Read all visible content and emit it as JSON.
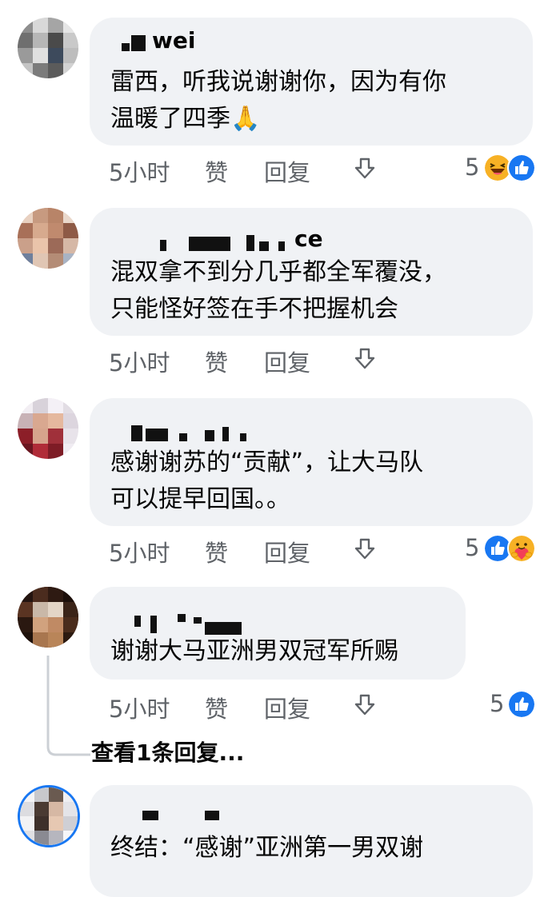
{
  "comments": [
    {
      "name_obscured": "wei",
      "lines": [
        "雷西，听我说谢谢你，因为有你",
        "温暖了四季🙏"
      ],
      "time": "5小时",
      "like": "赞",
      "reply": "回复",
      "reactions_count": "5",
      "reactions": [
        "haha-icon",
        "like-icon"
      ]
    },
    {
      "name_obscured": "ce",
      "lines": [
        "混双拿不到分几乎都全军覆没，",
        "只能怪好签在手不把握机会"
      ],
      "time": "5小时",
      "like": "赞",
      "reply": "回复",
      "reactions_count": "",
      "reactions": []
    },
    {
      "name_obscured": "",
      "lines": [
        "感谢谢苏的“贡献”，让大马队",
        "可以提早回国。。"
      ],
      "time": "5小时",
      "like": "赞",
      "reply": "回复",
      "reactions_count": "5",
      "reactions": [
        "like-icon",
        "care-icon"
      ]
    },
    {
      "name_obscured": "",
      "lines": [
        "谢谢大马亚洲男双冠军所赐"
      ],
      "time": "5小时",
      "like": "赞",
      "reply": "回复",
      "reactions_count": "5",
      "reactions": [
        "like-icon"
      ],
      "view_replies": "查看1条回复..."
    },
    {
      "name_obscured": "",
      "lines": [
        "终结：“感谢”亚洲第一男双谢"
      ]
    }
  ],
  "colors": {
    "bubble": "#f0f2f5",
    "meta": "#5f6368",
    "like_blue": "#1877f2"
  }
}
